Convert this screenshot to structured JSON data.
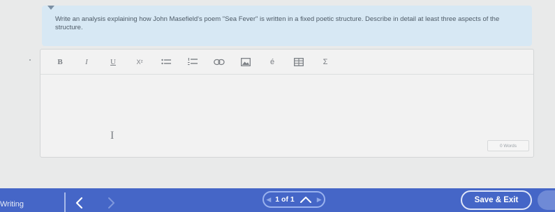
{
  "prompt": {
    "text": "Write an analysis explaining how John Masefield's poem \"Sea Fever\" is written in a fixed poetic structure. Describe in detail at least three aspects of the structure."
  },
  "toolbar": {
    "buttons": [
      {
        "name": "bold",
        "glyph": "B"
      },
      {
        "name": "italic",
        "glyph": "I"
      },
      {
        "name": "underline",
        "glyph": "U"
      },
      {
        "name": "superscript",
        "glyph": "X²"
      },
      {
        "name": "bulleted-list",
        "icon": "bulleted-list-icon"
      },
      {
        "name": "numbered-list",
        "icon": "numbered-list-icon"
      },
      {
        "name": "link",
        "icon": "link-icon"
      },
      {
        "name": "image",
        "icon": "image-icon"
      },
      {
        "name": "special-character",
        "glyph": "é"
      },
      {
        "name": "table",
        "icon": "table-icon"
      },
      {
        "name": "equation",
        "glyph": "Σ"
      }
    ]
  },
  "editor": {
    "text_cursor_glyph": "I",
    "word_count": "0 Words"
  },
  "bottom_bar": {
    "section_label": "Writing",
    "pager_text": "1 of 1",
    "save_exit_label": "Save & Exit"
  },
  "colors": {
    "prompt_bg": "#d7e8f4",
    "bar_bg": "#4566c7",
    "page_bg": "#e9eaea"
  }
}
